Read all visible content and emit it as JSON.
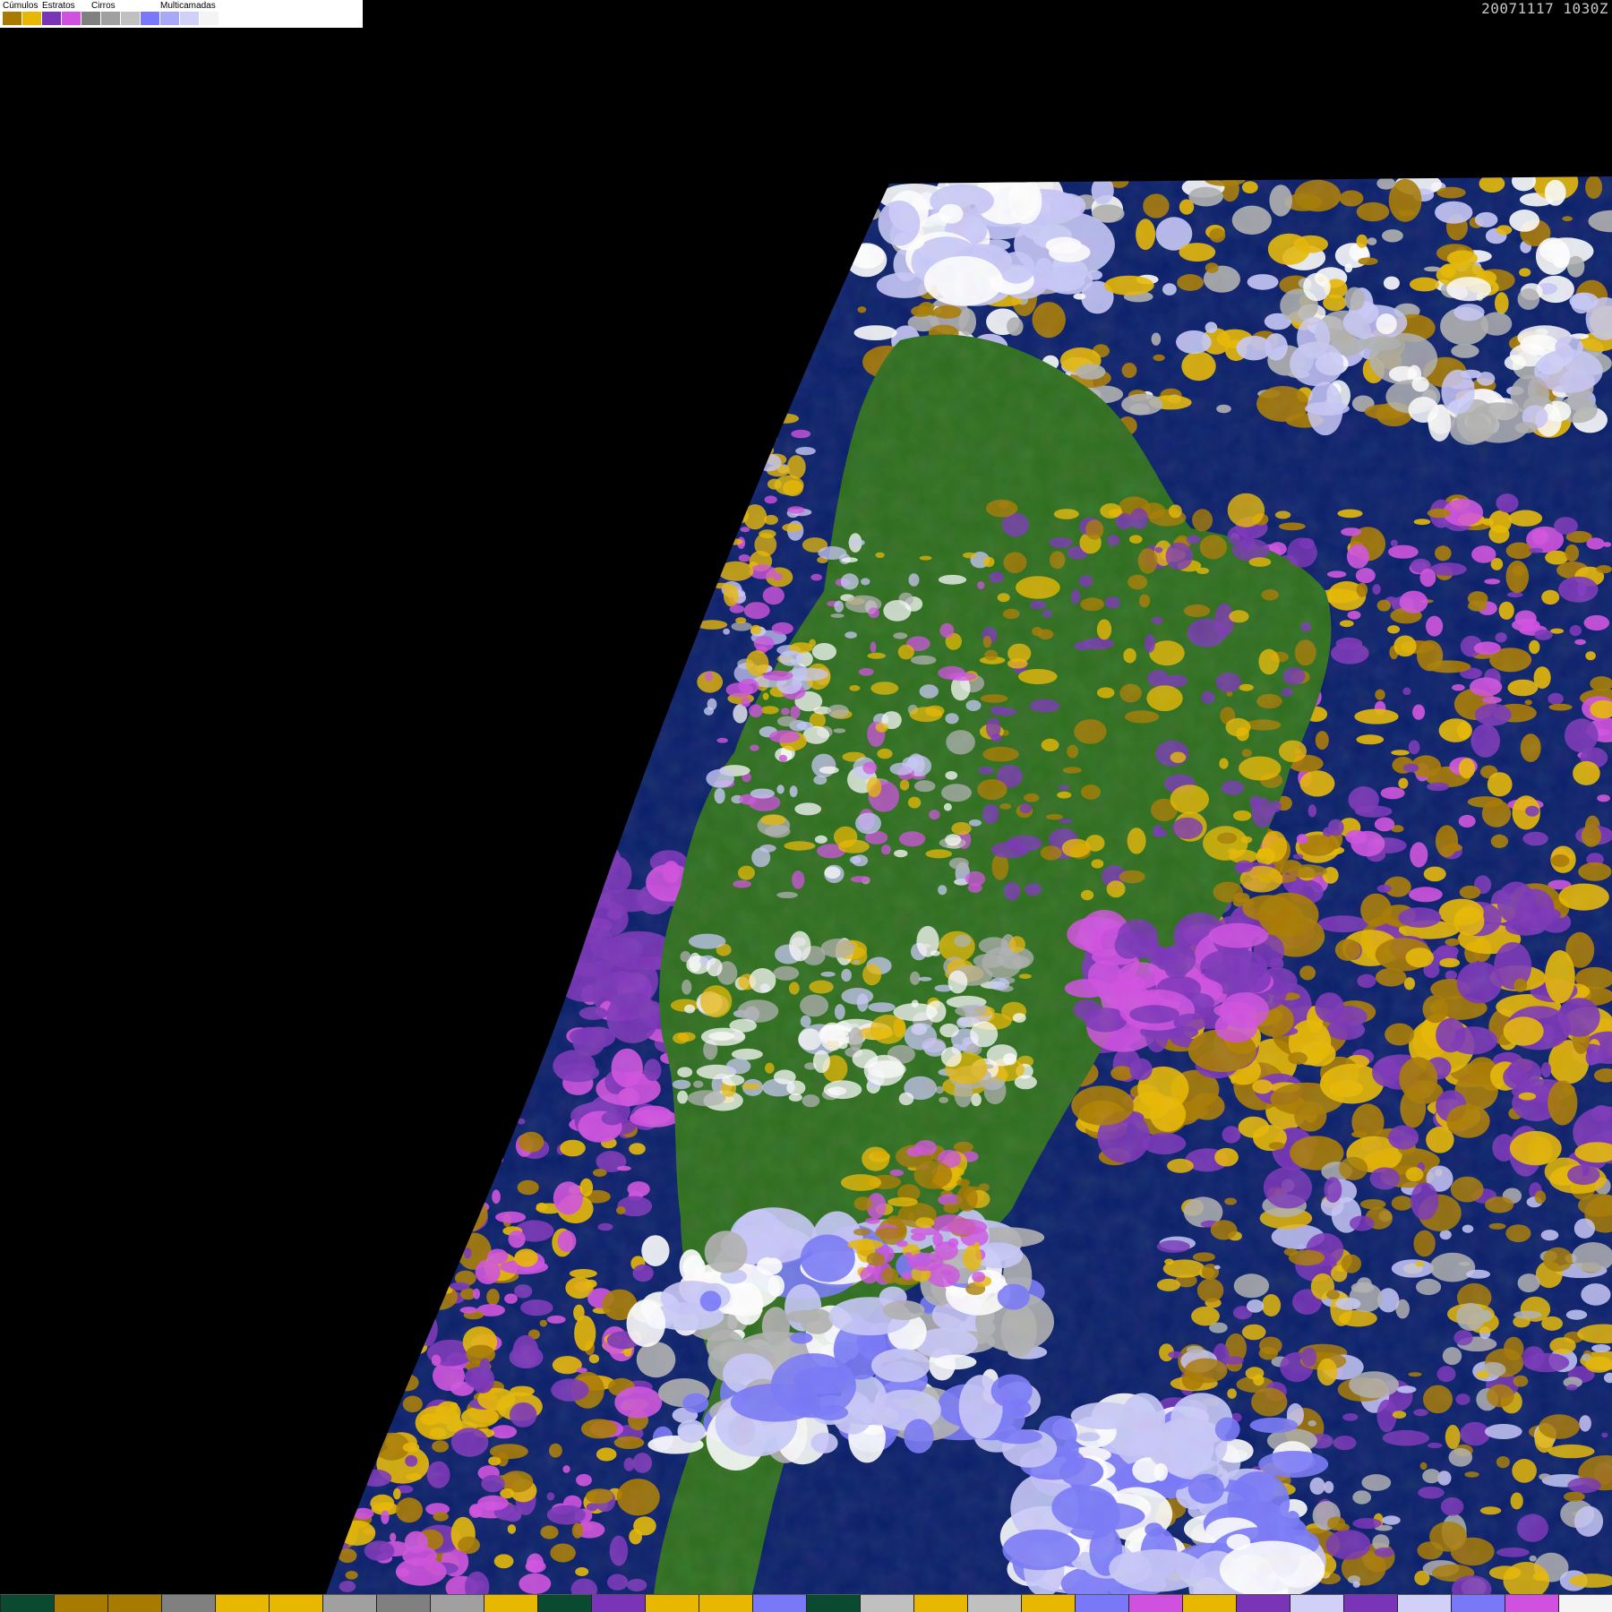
{
  "timestamp": "20071117 1030Z",
  "legend": {
    "groups": [
      {
        "label": "Cúmulos",
        "colors": [
          "#a87a00",
          "#e8b800"
        ]
      },
      {
        "label": "Estratos",
        "colors": [
          "#7a34b8",
          "#d050e0"
        ]
      },
      {
        "label": "Cirros",
        "colors": [
          "#808080",
          "#a0a0a0",
          "#c0c0c0"
        ]
      },
      {
        "label": "Multicamadas",
        "colors": [
          "#7878f8",
          "#a8a8f8",
          "#d0d0f8",
          "#f4f4f4"
        ]
      }
    ]
  },
  "map": {
    "colors": {
      "space": "#000000",
      "ocean": "#0a1f6a",
      "land": "#2e6e1e",
      "cumulus_low": "#a87a00",
      "cumulus_high": "#e8b800",
      "stratus_low": "#7a34b8",
      "stratus_high": "#d050e0",
      "cirrus": "#b0b0b0",
      "multilayer": "#c8c8f8"
    }
  },
  "bottom_bar": {
    "colors": [
      "#0a4a30",
      "#a87a00",
      "#a87a00",
      "#808080",
      "#e8b800",
      "#e8b800",
      "#a0a0a0",
      "#808080",
      "#a0a0a0",
      "#e8b800",
      "#0a4a30",
      "#7a34b8",
      "#e8b800",
      "#e8b800",
      "#7878f8",
      "#0a4a30",
      "#c0c0c0",
      "#e8b800",
      "#c0c0c0",
      "#e8b800",
      "#7878f8",
      "#d050e0",
      "#e8b800",
      "#7a34b8",
      "#d0d0f8",
      "#7a34b8",
      "#d0d0f8",
      "#7878f8",
      "#d050e0",
      "#f4f4f4"
    ]
  }
}
